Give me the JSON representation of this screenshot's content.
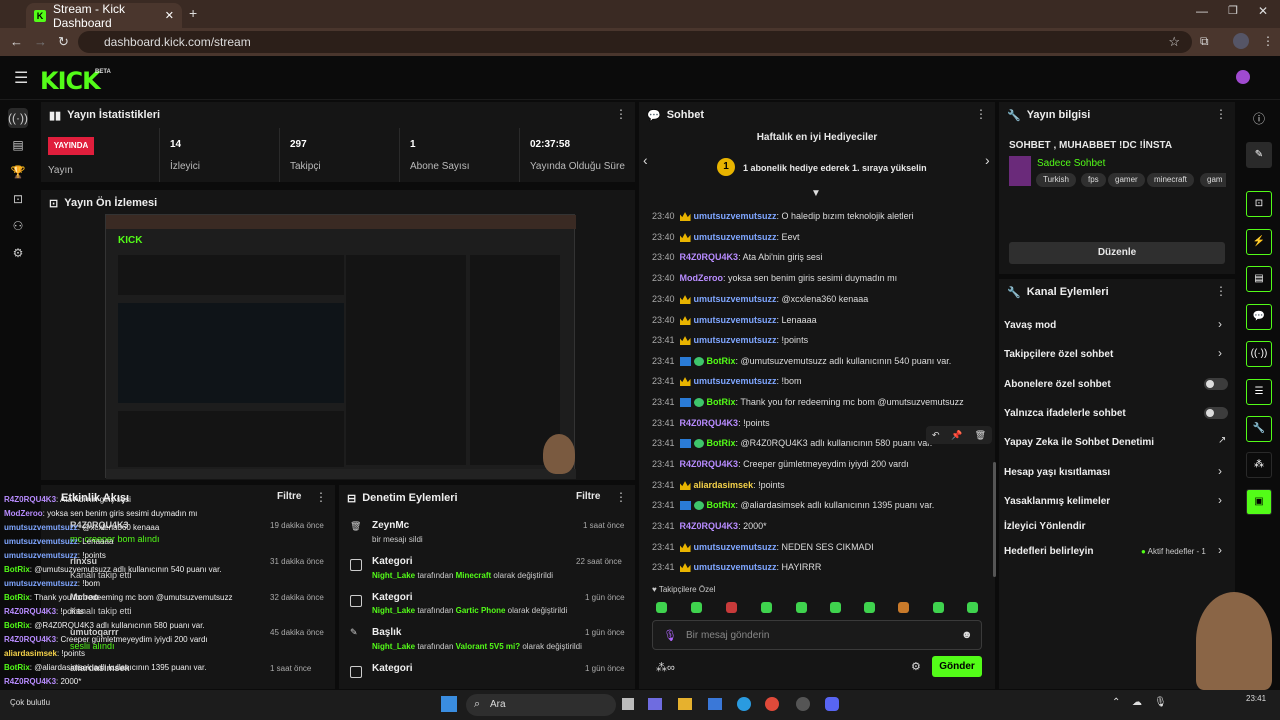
{
  "browser": {
    "tab_title": "Stream - Kick Dashboard",
    "url": "dashboard.kick.com/stream"
  },
  "brand": {
    "logo": "KICK",
    "beta": "BETA",
    "accent": "#53fc18"
  },
  "stats": {
    "title": "Yayın İstatistikleri",
    "live_badge": "YAYINDA",
    "live_label": "Yayın",
    "viewers_value": "14",
    "viewers_label": "İzleyici",
    "followers_value": "297",
    "followers_label": "Takipçi",
    "subs_value": "1",
    "subs_label": "Abone Sayısı",
    "uptime_value": "02:37:58",
    "uptime_label": "Yayında Olduğu Süre"
  },
  "preview": {
    "title": "Yayın Ön İzlemesi"
  },
  "activity": {
    "title": "Etkinlik Akışı",
    "filter": "Filtre",
    "items": [
      {
        "name": "R4Z0RQU4K3",
        "time": "19 dakika önce",
        "sub": "mc creeper bom alındı"
      },
      {
        "name": "rlnxsu",
        "time": "31 dakika önce",
        "sub": "Kanalı takip etti"
      },
      {
        "name": "Mcboo",
        "time": "32 dakika önce",
        "sub": "Kanalı takip etti"
      },
      {
        "name": "umutoqarrr",
        "time": "45 dakika önce",
        "sub": "seslii alındı"
      },
      {
        "name": "aliardasimsek",
        "time": "1 saat önce",
        "sub": ""
      }
    ]
  },
  "moderation": {
    "title": "Denetim Eylemleri",
    "filter": "Filtre",
    "items": [
      {
        "title": "ZeynMc",
        "sub": "bir mesajı sildi",
        "time": "1 saat önce"
      },
      {
        "title": "Kategori",
        "user": "Night_Lake",
        "mid": "tarafından",
        "value": "Minecraft",
        "rest": "olarak değiştirildi",
        "time": "22 saat önce"
      },
      {
        "title": "Kategori",
        "user": "Night_Lake",
        "mid": "tarafından",
        "value": "Gartic Phone",
        "rest": "olarak değiştirildi",
        "time": "1 gün önce"
      },
      {
        "title": "Başlık",
        "user": "Night_Lake",
        "mid": "tarafından",
        "value": "Valorant 5V5 mi?",
        "rest": "olarak değiştirildi",
        "time": "1 gün önce"
      },
      {
        "title": "Kategori",
        "time": "1 gün önce"
      }
    ]
  },
  "chat": {
    "title": "Sohbet",
    "gifter_title": "Haftalık en iyi Hediyeciler",
    "gifter_rank": "1",
    "gifter_text": "1 abonelik hediye ederek 1. sıraya yükselin",
    "messages": [
      {
        "time": "23:40",
        "badge": "crown",
        "user": "umutsuzvemutsuzz",
        "color": "#7fa6ff",
        "text": ": O haledip bızım teknolojik aletleri"
      },
      {
        "time": "23:40",
        "badge": "crown",
        "user": "umutsuzvemutsuzz",
        "color": "#7fa6ff",
        "text": ": Eevt"
      },
      {
        "time": "23:40",
        "badge": "",
        "user": "R4Z0RQU4K3",
        "color": "#b88cff",
        "text": ": Ata Abi'nin giriş sesi"
      },
      {
        "time": "23:40",
        "badge": "",
        "user": "ModZeroo",
        "color": "#b88cff",
        "text": ": yoksa sen benim giris sesimi duymadın mı"
      },
      {
        "time": "23:40",
        "badge": "crown",
        "user": "umutsuzvemutsuzz",
        "color": "#7fa6ff",
        "text": ": @xcxlena360 kenaaa"
      },
      {
        "time": "23:40",
        "badge": "crown",
        "user": "umutsuzvemutsuzz",
        "color": "#7fa6ff",
        "text": ": Lenaaaa"
      },
      {
        "time": "23:41",
        "badge": "crown",
        "user": "umutsuzvemutsuzz",
        "color": "#7fa6ff",
        "text": ": !points"
      },
      {
        "time": "23:41",
        "badge": "bot",
        "user": "BotRix",
        "color": "#53fc18",
        "text": ": @umutsuzvemutsuzz adlı kullanıcının 540 puanı var."
      },
      {
        "time": "23:41",
        "badge": "crown",
        "user": "umutsuzvemutsuzz",
        "color": "#7fa6ff",
        "text": ": !bom"
      },
      {
        "time": "23:41",
        "badge": "bot",
        "user": "BotRix",
        "color": "#53fc18",
        "text": ": Thank you for redeeming mc bom @umutsuzvemutsuzz"
      },
      {
        "time": "23:41",
        "badge": "",
        "user": "R4Z0RQU4K3",
        "color": "#b88cff",
        "text": ": !points"
      },
      {
        "time": "23:41",
        "badge": "bot",
        "user": "BotRix",
        "color": "#53fc18",
        "text": ": @R4Z0RQU4K3 adlı kullanıcının 580 puanı var."
      },
      {
        "time": "23:41",
        "badge": "",
        "user": "R4Z0RQU4K3",
        "color": "#b88cff",
        "text": ": Creeper gümletmeyeydim iyiydi 200 vardı"
      },
      {
        "time": "23:41",
        "badge": "crown",
        "user": "aliardasimsek",
        "color": "#f5d24a",
        "text": ": !points"
      },
      {
        "time": "23:41",
        "badge": "bot",
        "user": "BotRix",
        "color": "#53fc18",
        "text": ": @aliardasimsek adlı kullanıcının 1395 puanı var."
      },
      {
        "time": "23:41",
        "badge": "",
        "user": "R4Z0RQU4K3",
        "color": "#b88cff",
        "text": ": 2000*"
      },
      {
        "time": "23:41",
        "badge": "crown",
        "user": "umutsuzvemutsuzz",
        "color": "#7fa6ff",
        "text": ": NEDEN SES CIKMADI"
      },
      {
        "time": "23:41",
        "badge": "crown",
        "user": "umutsuzvemutsuzz",
        "color": "#7fa6ff",
        "text": ": HAYIRRR"
      }
    ],
    "followers_only": "Takipçilere Özel",
    "input_placeholder": "Bir mesaj gönderin",
    "send": "Gönder"
  },
  "stream_info": {
    "title": "Yayın bilgisi",
    "stream_title": "SOHBET , MUHABBET !DC !İNSTA",
    "category": "Sadece Sohbet",
    "tags": [
      "Turkish",
      "fps",
      "gamer",
      "minecraft",
      "gam"
    ],
    "edit": "Düzenle"
  },
  "channel_actions": {
    "title": "Kanal Eylemleri",
    "slow_mode": "Yavaş mod",
    "followers_chat": "Takipçilere özel sohbet",
    "subs_chat": "Abonelere özel sohbet",
    "emote_only": "Yalnızca ifadelerle sohbet",
    "ai_moderation": "Yapay Zeka ile Sohbet Denetimi",
    "age_restrict": "Hesap yaşı kısıtlaması",
    "banned_words": "Yasaklanmış kelimeler",
    "redirect": "İzleyici Yönlendir",
    "goals": "Hedefleri belirleyin",
    "goals_status": "Aktif hedefler - 1"
  },
  "overlay_chat": [
    {
      "user": "R4Z0RQU4K3",
      "text": ": Ata Abi'nin giriş sesi"
    },
    {
      "user": "ModZeroo",
      "text": ": yoksa sen benim giris sesimi duymadın mı"
    },
    {
      "user": "umutsuzvemutsuzz",
      "text": ": @xcxlena360 kenaaa"
    },
    {
      "user": "umutsuzvemutsuzz",
      "text": ": Lenaaaa"
    },
    {
      "user": "umutsuzvemutsuzz",
      "text": ": !points"
    },
    {
      "user": "BotRix",
      "text": ": @umutsuzvemutsuzz adlı kullanıcının 540 puanı var."
    },
    {
      "user": "umutsuzvemutsuzz",
      "text": ": !bom"
    },
    {
      "user": "BotRix",
      "text": ": Thank you for redeeming mc bom @umutsuzvemutsuzz"
    },
    {
      "user": "R4Z0RQU4K3",
      "text": ": !points"
    },
    {
      "user": "BotRix",
      "text": ": @R4Z0RQU4K3 adlı kullanıcının 580 puanı var."
    },
    {
      "user": "R4Z0RQU4K3",
      "text": ": Creeper gümletmeyeydim iyiydi 200 vardı"
    },
    {
      "user": "aliardasimsek",
      "text": ": !points"
    },
    {
      "user": "BotRix",
      "text": ": @aliardasimsek adlı kullanıcının 1395 puanı var."
    },
    {
      "user": "R4Z0RQU4K3",
      "text": ": 2000*"
    },
    {
      "user": "umutsuzvemutsuzz",
      "text": ": NEDEN SES CIKMADI"
    },
    {
      "user": "umutsuzvemutsuzz",
      "text": ": HAYIRRR"
    }
  ],
  "taskbar": {
    "search": "Ara",
    "time": "23:41",
    "weather": "Çok bulutlu"
  }
}
